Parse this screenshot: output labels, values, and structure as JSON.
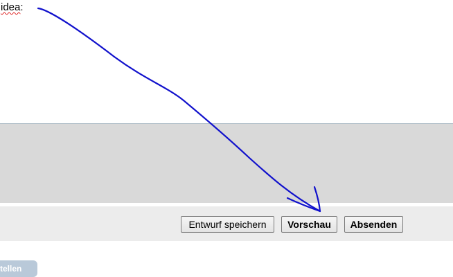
{
  "editor": {
    "text_word": "idea",
    "text_suffix": ":"
  },
  "buttons": {
    "draft_label": "Entwurf speichern",
    "preview_label": "Vorschau",
    "submit_label": "Absenden"
  },
  "bottom_tab": {
    "label": "tellen"
  },
  "colors": {
    "highlight": "#f3f100",
    "annotation_stroke": "#1111cc",
    "grey_panel": "#d9d9d9"
  }
}
